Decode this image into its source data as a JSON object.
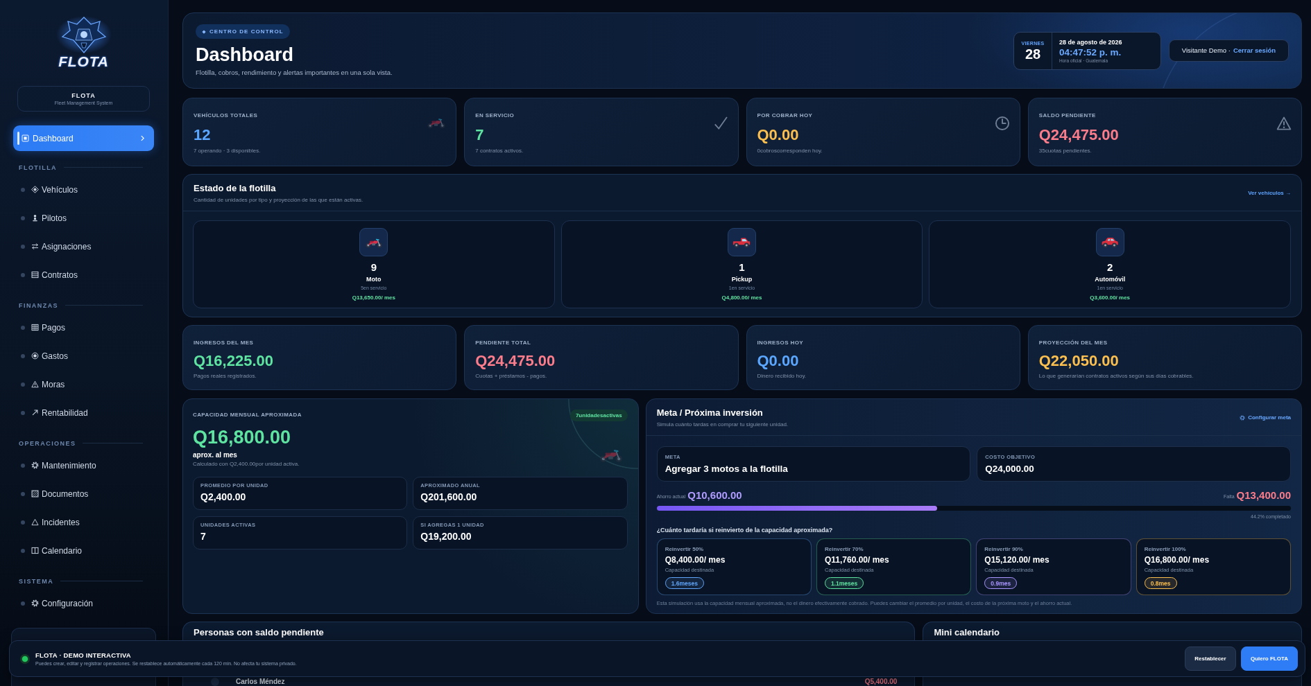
{
  "sidebar": {
    "logo": {
      "text": "FLOTA"
    },
    "brand": {
      "name": "FLOTA",
      "tagline": "Fleet Management System"
    },
    "top_items": [
      {
        "label": "Dashboard",
        "kind": "dashboard",
        "selected": true
      }
    ],
    "sections": [
      {
        "title": "FLOTILLA",
        "items": [
          {
            "label": "Vehículos",
            "kind": "diamond",
            "selected": false
          },
          {
            "label": "Pilotos",
            "kind": "person",
            "selected": false
          },
          {
            "label": "Asignaciones",
            "kind": "swap",
            "selected": false
          },
          {
            "label": "Contratos",
            "kind": "lines",
            "selected": false
          }
        ]
      },
      {
        "title": "FINANZAS",
        "items": [
          {
            "label": "Pagos",
            "kind": "grid",
            "selected": false
          },
          {
            "label": "Gastos",
            "kind": "target",
            "selected": false
          },
          {
            "label": "Moras",
            "kind": "warning",
            "selected": false
          },
          {
            "label": "Rentabilidad",
            "kind": "trend",
            "selected": false
          }
        ]
      },
      {
        "title": "OPERACIONES",
        "items": [
          {
            "label": "Mantenimiento",
            "kind": "gear",
            "selected": false
          },
          {
            "label": "Documentos",
            "kind": "hatched",
            "selected": false
          },
          {
            "label": "Incidentes",
            "kind": "triangle",
            "selected": false
          },
          {
            "label": "Calendario",
            "kind": "split",
            "selected": false
          }
        ]
      },
      {
        "title": "SISTEMA",
        "items": [
          {
            "label": "Configuración",
            "kind": "gear",
            "selected": false
          }
        ]
      }
    ]
  },
  "header": {
    "badge": "CENTRO DE CONTROL",
    "title": "Dashboard",
    "subtitle": "Flotilla, cobros, rendimiento y alertas importantes en una sola vista.",
    "date": {
      "weekday": "VIERNES",
      "day": "28",
      "full_date": "28 de agosto de 2026",
      "time": "04:47:52 p. m.",
      "zone": "Hora oficial · Guatemala"
    },
    "session": {
      "user": "Visitante Demo ·",
      "logout": "Cerrar sesión"
    }
  },
  "stats": [
    {
      "label": "VEHÍCULOS TOTALES",
      "value": "12",
      "note": "7 operando · 3 disponibles.",
      "kind": "moto",
      "color": "#5ba7ff"
    },
    {
      "label": "EN SERVICIO",
      "value": "7",
      "note": "7 contratos activos.",
      "kind": "check",
      "color": "#5fe3a1"
    },
    {
      "label": "POR COBRAR HOY",
      "value": "Q0.00",
      "note": "0cobroscorresponden hoy.",
      "kind": "clock",
      "color": "#fbbf4f"
    },
    {
      "label": "SALDO PENDIENTE",
      "value": "Q24,475.00",
      "note": "35cuotas pendientes.",
      "kind": "warning",
      "color": "#fb7c8a"
    }
  ],
  "fleet": {
    "title": "Estado de la flotilla",
    "subtitle": "Cantidad de unidades por tipo y proyección de las que están activas.",
    "link": "Ver vehículos →",
    "types": [
      {
        "kind": "moto",
        "count": "9",
        "name": "Moto",
        "status": "5en servicio",
        "income": "Q13,650.00/ mes"
      },
      {
        "kind": "pickup",
        "count": "1",
        "name": "Pickup",
        "status": "1en servicio",
        "income": "Q4,800.00/ mes"
      },
      {
        "kind": "car",
        "count": "2",
        "name": "Automóvil",
        "status": "1en servicio",
        "income": "Q3,600.00/ mes"
      }
    ]
  },
  "income": [
    {
      "label": "INGRESOS DEL MES",
      "value": "Q16,225.00",
      "note": "Pagos reales registrados.",
      "color": "#5fe3a1"
    },
    {
      "label": "PENDIENTE TOTAL",
      "value": "Q24,475.00",
      "note": "Cuotas + préstamos - pagos.",
      "color": "#fb7c8a"
    },
    {
      "label": "INGRESOS HOY",
      "value": "Q0.00",
      "note": "Dinero recibido hoy.",
      "color": "#5ba7ff"
    },
    {
      "label": "PROYECCIÓN DEL MES",
      "value": "Q22,050.00",
      "note": "Lo que generarían contratos activos según sus días cobrables.",
      "color": "#fbbf4f"
    }
  ],
  "capacity": {
    "label": "CAPACIDAD MENSUAL APROXIMADA",
    "badge": "7unidadesactivas",
    "value": "Q16,800.00",
    "unit": "aprox. al mes",
    "note": "Calculado con Q2,400.00por unidad activa.",
    "metrics": [
      {
        "label": "PROMEDIO POR UNIDAD",
        "value": "Q2,400.00"
      },
      {
        "label": "APROXIMADO ANUAL",
        "value": "Q201,600.00"
      },
      {
        "label": "UNIDADES ACTIVAS",
        "value": "7"
      },
      {
        "label": "SI AGREGAS 1 UNIDAD",
        "value": "Q19,200.00"
      }
    ]
  },
  "goal": {
    "title": "Meta / Próxima inversión",
    "subtitle": "Simula cuánto tardas en comprar tu siguiente unidad.",
    "link": "Configurar meta",
    "boxes": [
      {
        "label": "META",
        "value": "Agregar 3 motos a la flotilla"
      },
      {
        "label": "COSTO OBJETIVO",
        "value": "Q24,000.00"
      }
    ],
    "saved_label": "Ahorro actual",
    "saved": "Q10,600.00",
    "missing_label": "Falta",
    "missing": "Q13,400.00",
    "progress": {
      "level": 0.442,
      "label": "44.2% completado"
    },
    "question": "¿Cuánto tardaría si reinvierto de la capacidad aproximada?",
    "scenarios": [
      {
        "label": "Reinvertir 50%",
        "amount": "Q8,400.00/ mes",
        "note": "Capacidad destinada",
        "duration": "1.6meses",
        "color": "#60a5fa"
      },
      {
        "label": "Reinvertir 70%",
        "amount": "Q11,760.00/ mes",
        "note": "Capacidad destinada",
        "duration": "1.1meses",
        "color": "#5fe3a1"
      },
      {
        "label": "Reinvertir 90%",
        "amount": "Q15,120.00/ mes",
        "note": "Capacidad destinada",
        "duration": "0.9mes",
        "color": "#a996ff"
      },
      {
        "label": "Reinvertir 100%",
        "amount": "Q16,800.00/ mes",
        "note": "Capacidad destinada",
        "duration": "0.8mes",
        "color": "#fbbf4f"
      }
    ],
    "footnote": "Esta simulación usa la capacidad mensual aproximada, no el dinero efectivamente cobrado. Puedes cambiar el promedio por unidad, el costo de la próxima moto y el ahorro actual."
  },
  "pending": {
    "title": "Personas con saldo pendiente",
    "rows": [
      {
        "name": "Carlos Méndez",
        "amount": "Q5,400.00"
      }
    ]
  },
  "calendar": {
    "title": "Mini calendario"
  },
  "demo_banner": {
    "title": "FLOTA · DEMO INTERACTIVA",
    "text": "Puedes crear, editar y registrar operaciones. Se restablece automáticamente cada 120 min. No afecta tu sistema privado.",
    "buttons": [
      {
        "label": "Restablecer",
        "kind": "secondary"
      },
      {
        "label": "Quiero FLOTA",
        "kind": "primary"
      }
    ]
  }
}
